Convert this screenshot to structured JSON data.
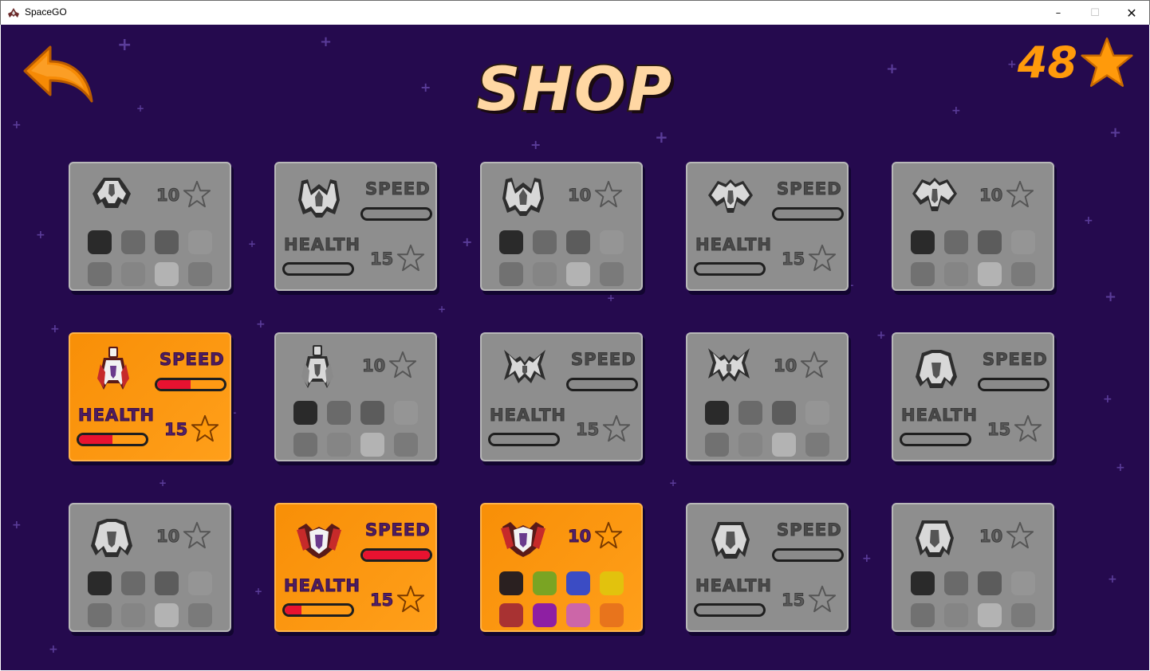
{
  "window": {
    "title": "SpaceGO",
    "minimize": "–",
    "maximize": "☐",
    "close": "✕"
  },
  "header": {
    "title": "SHOP",
    "stars_count": "48"
  },
  "colors": {
    "background": "#250a4e",
    "card_locked": "#8e8e8e",
    "card_owned": "#f88f07",
    "accent_orange": "#ff9a0b",
    "bar_fill": "#e81230"
  },
  "cards": [
    {
      "variant": "colors",
      "owned": false,
      "price": "10",
      "ship_icon": "ship-claw-icon",
      "swatch_colors": [
        "#2a2a2a",
        "#6a6a6a",
        "#5c5c5c",
        "#959595",
        "#717171",
        "#858585",
        "#b3b3b3",
        "#7a7a7a"
      ]
    },
    {
      "variant": "stats",
      "owned": false,
      "price": "15",
      "ship_icon": "ship-pincer-icon",
      "speed_label": "SPEED",
      "health_label": "HEALTH",
      "speed_fill": 0,
      "health_fill": 0
    },
    {
      "variant": "colors",
      "owned": false,
      "price": "10",
      "ship_icon": "ship-pincer-icon",
      "swatch_colors": [
        "#2a2a2a",
        "#6a6a6a",
        "#5c5c5c",
        "#959595",
        "#717171",
        "#858585",
        "#b3b3b3",
        "#7a7a7a"
      ]
    },
    {
      "variant": "stats",
      "owned": false,
      "price": "15",
      "ship_icon": "ship-wing-icon",
      "speed_label": "SPEED",
      "health_label": "HEALTH",
      "speed_fill": 0,
      "health_fill": 0
    },
    {
      "variant": "colors",
      "owned": false,
      "price": "10",
      "ship_icon": "ship-wing-icon",
      "swatch_colors": [
        "#2a2a2a",
        "#6a6a6a",
        "#5c5c5c",
        "#959595",
        "#717171",
        "#858585",
        "#b3b3b3",
        "#7a7a7a"
      ]
    },
    {
      "variant": "stats",
      "owned": true,
      "price": "15",
      "ship_icon": "ship-rocket-icon",
      "speed_label": "SPEED",
      "health_label": "HEALTH",
      "speed_fill": 0.5,
      "health_fill": 0.5
    },
    {
      "variant": "colors",
      "owned": false,
      "price": "10",
      "ship_icon": "ship-rocket-icon",
      "swatch_colors": [
        "#2a2a2a",
        "#6a6a6a",
        "#5c5c5c",
        "#959595",
        "#717171",
        "#858585",
        "#b3b3b3",
        "#7a7a7a"
      ]
    },
    {
      "variant": "stats",
      "owned": false,
      "price": "15",
      "ship_icon": "ship-x-icon",
      "speed_label": "SPEED",
      "health_label": "HEALTH",
      "speed_fill": 0,
      "health_fill": 0
    },
    {
      "variant": "colors",
      "owned": false,
      "price": "10",
      "ship_icon": "ship-x-icon",
      "swatch_colors": [
        "#2a2a2a",
        "#6a6a6a",
        "#5c5c5c",
        "#959595",
        "#717171",
        "#858585",
        "#b3b3b3",
        "#7a7a7a"
      ]
    },
    {
      "variant": "stats",
      "owned": false,
      "price": "15",
      "ship_icon": "ship-bulky-icon",
      "speed_label": "SPEED",
      "health_label": "HEALTH",
      "speed_fill": 0,
      "health_fill": 0
    },
    {
      "variant": "colors",
      "owned": false,
      "price": "10",
      "ship_icon": "ship-bulky-icon",
      "swatch_colors": [
        "#2a2a2a",
        "#6a6a6a",
        "#5c5c5c",
        "#959595",
        "#717171",
        "#858585",
        "#b3b3b3",
        "#7a7a7a"
      ]
    },
    {
      "variant": "stats",
      "owned": true,
      "price": "15",
      "ship_icon": "ship-shield-icon",
      "speed_label": "SPEED",
      "health_label": "HEALTH",
      "speed_fill": 1.0,
      "health_fill": 0.25
    },
    {
      "variant": "colors",
      "owned": true,
      "price": "10",
      "ship_icon": "ship-shield-icon",
      "swatch_colors": [
        "#2a2020",
        "#7aa423",
        "#3b4cc4",
        "#e2c20d",
        "#a83232",
        "#8e1fa3",
        "#cc66a8",
        "#e8741c"
      ]
    },
    {
      "variant": "stats",
      "owned": false,
      "price": "15",
      "ship_icon": "ship-cradle-icon",
      "speed_label": "SPEED",
      "health_label": "HEALTH",
      "speed_fill": 0,
      "health_fill": 0
    },
    {
      "variant": "colors",
      "owned": false,
      "price": "10",
      "ship_icon": "ship-cradle-icon",
      "swatch_colors": [
        "#2a2a2a",
        "#6a6a6a",
        "#5c5c5c",
        "#959595",
        "#717171",
        "#858585",
        "#b3b3b3",
        "#7a7a7a"
      ]
    }
  ]
}
